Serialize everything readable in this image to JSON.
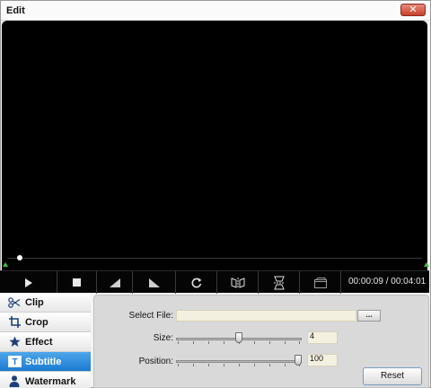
{
  "window": {
    "title": "Edit",
    "close_glyph": "✕"
  },
  "player": {
    "time_display": "00:00:09 / 00:04:01",
    "progress_fraction": 0.03,
    "controls": [
      {
        "name": "play-icon"
      },
      {
        "name": "stop-icon"
      },
      {
        "name": "volume-down-icon"
      },
      {
        "name": "volume-up-icon"
      },
      {
        "name": "rotate-icon"
      },
      {
        "name": "flip-horizontal-icon"
      },
      {
        "name": "flip-vertical-icon"
      },
      {
        "name": "snapshot-icon"
      }
    ]
  },
  "nav": {
    "items": [
      {
        "label": "Clip",
        "icon": "scissors-icon",
        "active": false
      },
      {
        "label": "Crop",
        "icon": "crop-icon",
        "active": false
      },
      {
        "label": "Effect",
        "icon": "star-icon",
        "active": false
      },
      {
        "label": "Subtitle",
        "icon": "subtitle-icon",
        "active": true
      },
      {
        "label": "Watermark",
        "icon": "person-icon",
        "active": false
      }
    ]
  },
  "subtitle": {
    "select_file_label": "Select File:",
    "file_value": "",
    "browse_label": "...",
    "size_label": "Size:",
    "size_value": "4",
    "size_fraction": 0.5,
    "position_label": "Position:",
    "position_value": "100",
    "position_fraction": 1.0,
    "reset_label": "Reset"
  },
  "colors": {
    "accent": "#1c7bd1",
    "video_bg": "#000000",
    "seek_marker": "#3cc23c"
  }
}
